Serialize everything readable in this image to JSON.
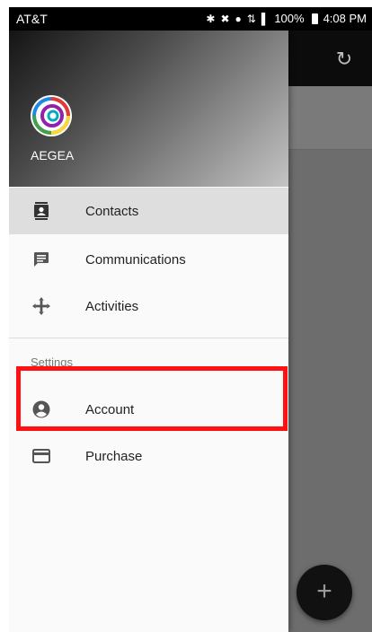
{
  "status_bar": {
    "carrier": "AT&T",
    "battery": "100%",
    "time": "4:08 PM"
  },
  "drawer": {
    "app_name": "AEGEA",
    "items": [
      {
        "label": "Contacts",
        "icon": "contacts-icon",
        "selected": true
      },
      {
        "label": "Communications",
        "icon": "message-icon"
      },
      {
        "label": "Activities",
        "icon": "activities-icon"
      }
    ],
    "settings_header": "Settings",
    "settings_items": [
      {
        "label": "Account",
        "icon": "account-icon"
      },
      {
        "label": "Purchase",
        "icon": "credit-card-icon"
      }
    ]
  },
  "background": {
    "fab_label": "+"
  },
  "colors": {
    "highlight": "#ff1111",
    "selected_row": "#dedede"
  }
}
